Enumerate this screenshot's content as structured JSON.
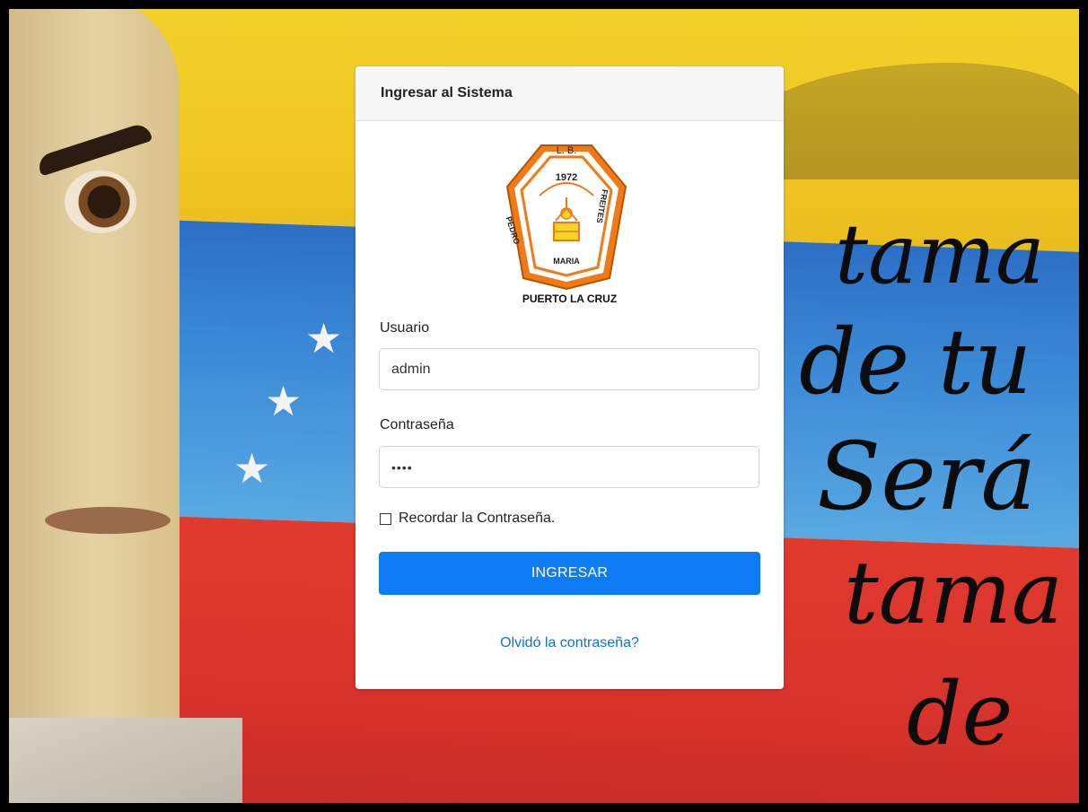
{
  "colors": {
    "primary": "#0d7cf4",
    "link": "#0b72d6",
    "logo_orange": "#f07a17"
  },
  "login": {
    "title": "Ingresar al Sistema",
    "username_label": "Usuario",
    "username_value": "admin",
    "password_label": "Contraseña",
    "password_value": "••••",
    "remember_label": "Recordar la Contraseña.",
    "remember_checked": false,
    "submit_label": "INGRESAR",
    "forgot_label": "Olvidó la contraseña?"
  },
  "logo": {
    "icon": "school-crest-icon",
    "top_text": "L. B.",
    "year": "1972",
    "left_text": "PEDRO",
    "bottom_text": "MARIA",
    "right_text": "FREITES",
    "caption": "PUERTO LA CRUZ"
  },
  "background": {
    "mural_words": [
      "tama",
      "de tu",
      "Será",
      "tama",
      "de"
    ]
  }
}
